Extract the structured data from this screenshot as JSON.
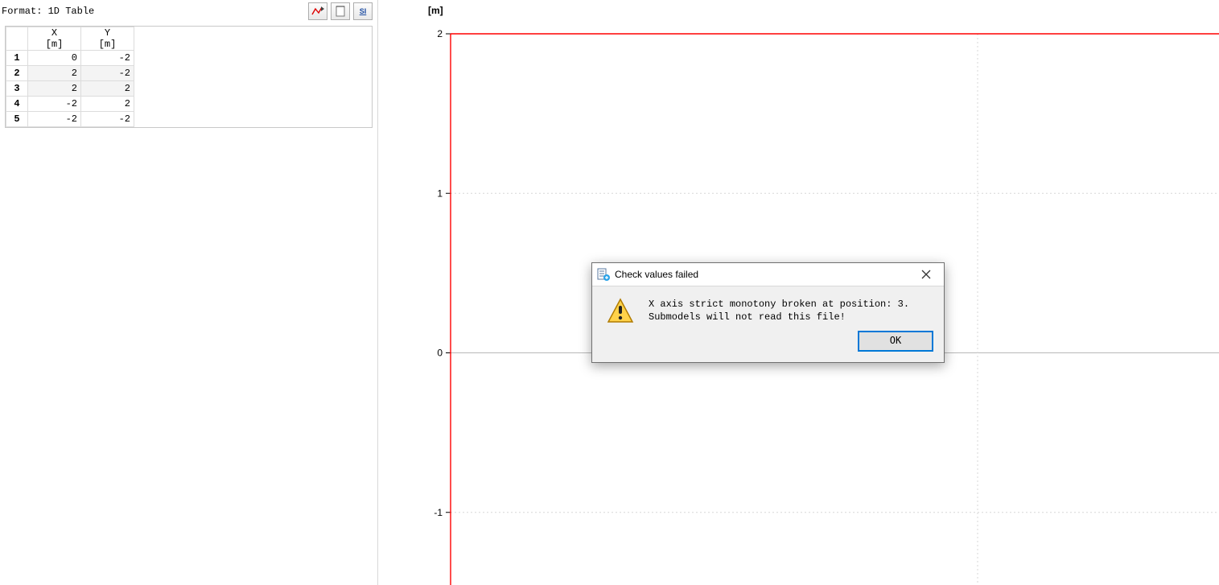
{
  "format_label": "Format: 1D Table",
  "toolbar": {
    "plot_icon": "plot-icon",
    "notes_icon": "notes-icon",
    "si_icon": "si-icon",
    "si_text": "SI"
  },
  "table": {
    "headers": {
      "x_name": "X",
      "x_unit": "[m]",
      "y_name": "Y",
      "y_unit": "[m]"
    },
    "rows": [
      {
        "idx": "1",
        "x": "0",
        "y": "-2",
        "shade": false
      },
      {
        "idx": "2",
        "x": "2",
        "y": "-2",
        "shade": true
      },
      {
        "idx": "3",
        "x": "2",
        "y": "2",
        "shade": true
      },
      {
        "idx": "4",
        "x": "-2",
        "y": "2",
        "shade": false
      },
      {
        "idx": "5",
        "x": "-2",
        "y": "-2",
        "shade": false
      }
    ]
  },
  "chart_data": {
    "type": "line",
    "title": "",
    "xlabel": "",
    "ylabel": "[m]",
    "ylim": [
      -2,
      2
    ],
    "yticks": [
      -1,
      0,
      1,
      2
    ],
    "series": [
      {
        "name": "",
        "x": [
          0,
          2,
          2,
          -2,
          -2
        ],
        "y": [
          -2,
          -2,
          2,
          2,
          -2
        ]
      }
    ],
    "visible_line": {
      "description": "single red horizontal segment at y=2 spanning plot area",
      "y": 2,
      "color": "#ff0000"
    }
  },
  "plot_axis_title": "[m]",
  "yticks": [
    "2",
    "1",
    "0",
    "-1"
  ],
  "dialog": {
    "title": "Check values failed",
    "line1": "X axis strict monotony broken at position: 3.",
    "line2": "Submodels will not read this file!",
    "ok": "OK"
  }
}
